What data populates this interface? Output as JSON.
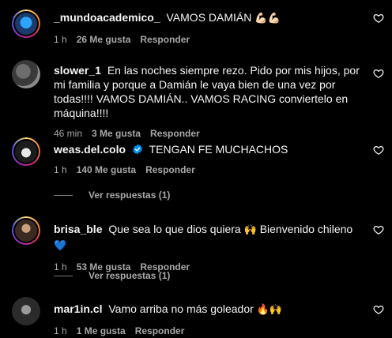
{
  "comments": [
    {
      "username": "_mundoacademico_",
      "text": "VAMOS DAMIÁN",
      "emoji": "💪🏻💪🏻",
      "time": "1 h",
      "likes": "26 Me gusta",
      "reply": "Responder"
    },
    {
      "username": "slower_1",
      "text": "En las noches siempre rezo. Pido por mis hijos, por mi familia y porque a Damián le vaya bien de una vez por todas!!!! VAMOS DAMIÁN.. VAMOS RACING conviertelo en máquina!!!!",
      "time": "46 min",
      "likes": "3 Me gusta",
      "reply": "Responder"
    },
    {
      "username": "weas.del.colo",
      "text": "TENGAN FE MUCHACHOS",
      "time": "1 h",
      "likes": "140 Me gusta",
      "reply": "Responder",
      "view_replies": "Ver respuestas (1)"
    },
    {
      "username": "brisa_ble",
      "text": "Que sea lo que dios quiera",
      "emoji1": "🙌",
      "text2": "Bienvenido chileno",
      "emoji2": "💙",
      "time": "1 h",
      "likes": "53 Me gusta",
      "reply": "Responder",
      "view_replies": "Ver respuestas (1)"
    },
    {
      "username": "mar1in.cl",
      "text": "Vamo arriba no más goleador",
      "emoji": "🔥🙌",
      "time": "1 h",
      "likes": "1 Me gusta",
      "reply": "Responder"
    }
  ],
  "icons": {
    "like": "heart-outline-icon",
    "verified": "verified-badge-icon"
  },
  "colors": {
    "background": "#000000",
    "text": "#f5f5f5",
    "meta": "#a8a8a8",
    "verified": "#0095f6"
  }
}
